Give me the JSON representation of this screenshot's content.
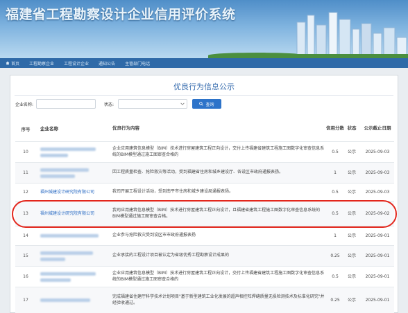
{
  "banner": {
    "title": "福建省工程勘察设计企业信用评价系统"
  },
  "nav": {
    "items": [
      "首页",
      "工程勘察企业",
      "工程设计企业",
      "通知公告",
      "主管部门电话"
    ]
  },
  "page": {
    "title": "优良行为信息公示"
  },
  "filter": {
    "company_label": "企业名称:",
    "status_label": "状态:",
    "search_label": "查询"
  },
  "table": {
    "headers": {
      "no": "序号",
      "name": "企业名称",
      "content": "优良行为内容",
      "score": "信用分数",
      "status": "状态",
      "date": "公示截止日期"
    },
    "rows": [
      {
        "no": "10",
        "name": "",
        "content": "企业应用建筑信息模型（BIM）技术进行房屋建筑工程正向设计，交付上传福建省建筑工程施工图数字化审查信息系统的BIM模型通过施工图审查合格的",
        "score": "0.5",
        "status": "公示",
        "date": "2025-09-03"
      },
      {
        "no": "11",
        "name": "",
        "content": "因工程质量检查、抢险救灾等活动，受到福建省住房和城乡建设厅、各设区市政府通报表扬。",
        "score": "1",
        "status": "公示",
        "date": "2025-09-03"
      },
      {
        "no": "12",
        "name": "福州城建设计研究院有限公司",
        "content": "我司开展工程设计活动，受到南平市住房和城乡建设局通报表扬。",
        "score": "0.5",
        "status": "公示",
        "date": "2025-09-03"
      },
      {
        "no": "13",
        "name": "福州城建设计研究院有限公司",
        "content": "我司应用建筑信息模型（BIM）技术进行房屋建筑工程正向设计，且福建省建筑工程施工图数字化审查信息系统的BIM模型通过施工图审查合格。",
        "score": "0.5",
        "status": "公示",
        "date": "2025-09-02"
      },
      {
        "no": "14",
        "name": "",
        "content": "企业参与抢险救灾受到设区市市政府通报表扬",
        "score": "1",
        "status": "公示",
        "date": "2025-09-01"
      },
      {
        "no": "15",
        "name": "",
        "content": "企业承接的工程设计项目被认定为省级优秀工程勘察设计成果的",
        "score": "0.25",
        "status": "公示",
        "date": "2025-09-01"
      },
      {
        "no": "16",
        "name": "",
        "content": "企业应用建筑信息模型（BIM）技术进行房屋建筑工程正向设计，交付上传福建省建筑工程施工图数字化审查信息系统的BIM模型通过施工图审查合格的",
        "score": "0.5",
        "status": "公示",
        "date": "2025-09-01"
      },
      {
        "no": "17",
        "name": "",
        "content": "完成福建省住建厅科学技术计划项目\"基于新型建筑工业化发展的超声相控阵焊缝质量无损检测技术及标准化研究\"并经验收通过。",
        "score": "0.25",
        "status": "公示",
        "date": "2025-09-01"
      }
    ]
  }
}
